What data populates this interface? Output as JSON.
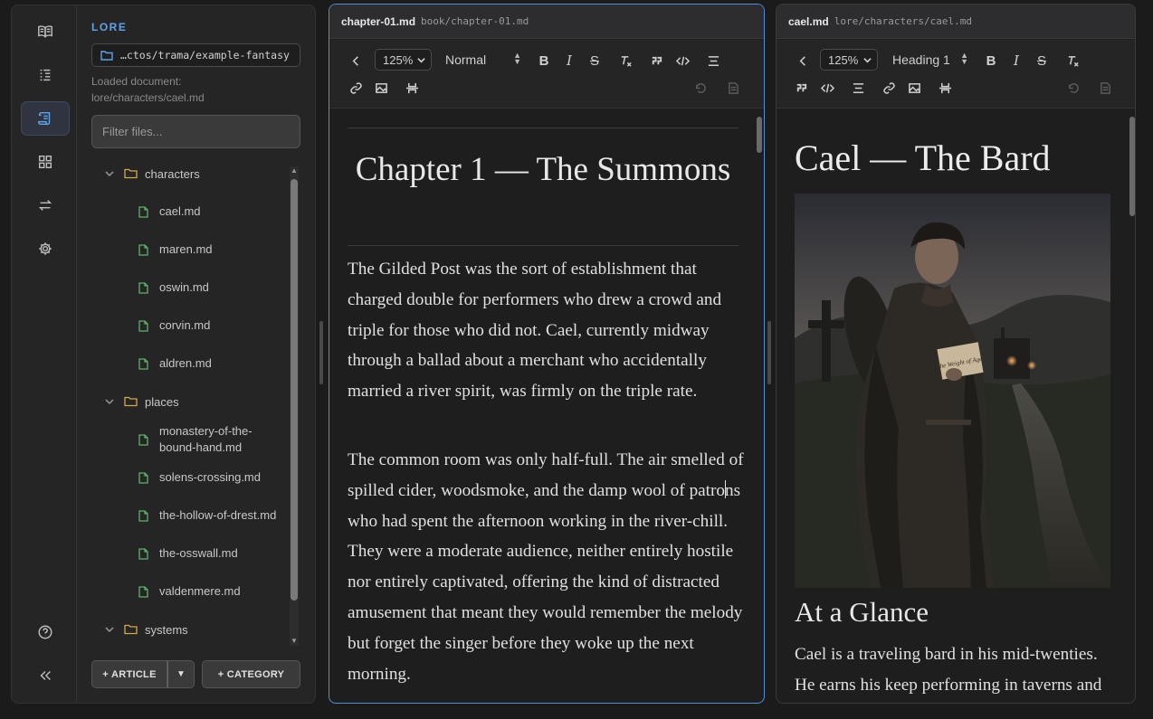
{
  "window": {
    "minimize_glyph": "—",
    "maximize_glyph": "☐",
    "close_glyph": "✕"
  },
  "rail": {
    "items": [
      {
        "name": "book-icon",
        "active": false
      },
      {
        "name": "outline-list-icon",
        "active": false
      },
      {
        "name": "scroll-icon",
        "active": true
      },
      {
        "name": "grid-icon",
        "active": false
      },
      {
        "name": "sync-arrows-icon",
        "active": false
      },
      {
        "name": "gear-icon",
        "active": false
      }
    ],
    "bottom": [
      {
        "name": "help-icon"
      },
      {
        "name": "collapse-icon"
      }
    ],
    "help_glyph": "?",
    "collapse_glyph": "«"
  },
  "files": {
    "title": "LORE",
    "path": "…ctos/trama/example-fantasy",
    "loaded_label": "Loaded document:",
    "loaded_path": "lore/characters/cael.md",
    "filter_placeholder": "Filter files...",
    "tree": [
      {
        "type": "folder",
        "label": "characters"
      },
      {
        "type": "file",
        "label": "cael.md"
      },
      {
        "type": "file",
        "label": "maren.md"
      },
      {
        "type": "file",
        "label": "oswin.md"
      },
      {
        "type": "file",
        "label": "corvin.md"
      },
      {
        "type": "file",
        "label": "aldren.md"
      },
      {
        "type": "folder",
        "label": "places"
      },
      {
        "type": "file",
        "label": "monastery-of-the-bound-hand.md"
      },
      {
        "type": "file",
        "label": "solens-crossing.md"
      },
      {
        "type": "file",
        "label": "the-hollow-of-drest.md"
      },
      {
        "type": "file",
        "label": "the-osswall.md"
      },
      {
        "type": "file",
        "label": "valdenmere.md"
      },
      {
        "type": "folder",
        "label": "systems"
      }
    ],
    "article_button": "+ ARTICLE",
    "article_dropdown": "▼",
    "category_button": "+ CATEGORY"
  },
  "left_pane": {
    "filename": "chapter-01.md",
    "path": "book/chapter-01.md",
    "zoom": "125%",
    "format": "Normal",
    "title": "Chapter 1 — The Summons",
    "para1": "The Gilded Post was the sort of establishment that charged double for performers who drew a crowd and triple for those who did not. Cael, currently midway through a ballad about a merchant who accidentally married a river spirit, was firmly on the triple rate.",
    "para2_before_caret": "The common room was only half-full. The air smelled of spilled cider, woodsmoke, and the damp wool of patro",
    "para2_after_caret": "ns who had spent the afternoon working in the river-chill. They were a moderate audience, neither entirely hostile nor entirely captivated, offering the kind of distracted amusement that meant they would remember the melody but forget the singer before they woke up the next morning."
  },
  "right_pane": {
    "filename": "cael.md",
    "path": "lore/characters/cael.md",
    "zoom": "125%",
    "format": "Heading 1",
    "title": "Cael — The Bard",
    "portrait_note": "The Weight of Ages",
    "section": "At a Glance",
    "para": "Cael is a traveling bard in his mid-twenties. He earns his keep performing in taverns and at roadside inns."
  },
  "toolbar_glyphs": {
    "bold": "B",
    "italic": "I",
    "strike": "S",
    "clear": "Tx",
    "quote": "❞",
    "code": "</>",
    "updown": "▲▼"
  },
  "colors": {
    "accent": "#5ea2e8",
    "folder": "#d4a94a",
    "file": "#5fb16a",
    "focus_border": "#4e8fd6"
  }
}
